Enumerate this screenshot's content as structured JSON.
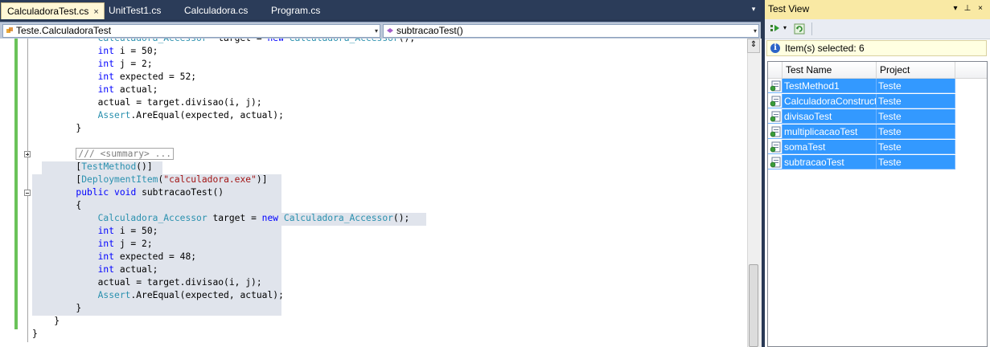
{
  "tabs": [
    {
      "label": "CalculadoraTest.cs",
      "active": true,
      "close": "×"
    },
    {
      "label": "UnitTest1.cs"
    },
    {
      "label": "Calculadora.cs"
    },
    {
      "label": "Program.cs"
    }
  ],
  "tab_dropdown": "▾",
  "nav": {
    "class_combo": "Teste.CalculadoraTest",
    "member_combo": "subtracaoTest()",
    "dropdown_glyph": "▾"
  },
  "code": {
    "lines": [
      {
        "indent": "            ",
        "tokens": [
          [
            "ty",
            "Calculadora_Accessor"
          ],
          [
            "",
            "  target = "
          ],
          [
            "kw",
            "new"
          ],
          [
            "",
            " "
          ],
          [
            "ty",
            "Calculadora_Accessor"
          ],
          [
            "",
            "();"
          ]
        ]
      },
      {
        "indent": "            ",
        "tokens": [
          [
            "kw",
            "int"
          ],
          [
            "",
            " i = 50;"
          ]
        ]
      },
      {
        "indent": "            ",
        "tokens": [
          [
            "kw",
            "int"
          ],
          [
            "",
            " j = 2;"
          ]
        ]
      },
      {
        "indent": "            ",
        "tokens": [
          [
            "kw",
            "int"
          ],
          [
            "",
            " expected = 52;"
          ]
        ]
      },
      {
        "indent": "            ",
        "tokens": [
          [
            "kw",
            "int"
          ],
          [
            "",
            " actual;"
          ]
        ]
      },
      {
        "indent": "            ",
        "tokens": [
          [
            "",
            "actual = target.divisao(i, j);"
          ]
        ]
      },
      {
        "indent": "            ",
        "tokens": [
          [
            "ty",
            "Assert"
          ],
          [
            "",
            ".AreEqual(expected, actual);"
          ]
        ]
      },
      {
        "indent": "        ",
        "tokens": [
          [
            "",
            "}"
          ]
        ]
      },
      {
        "indent": "",
        "tokens": []
      },
      {
        "indent": "        ",
        "tokens": [
          [
            "cm collapsed",
            "/// <summary> ..."
          ]
        ]
      },
      {
        "indent": "        ",
        "tokens": [
          [
            "",
            "["
          ],
          [
            "ty",
            "TestMethod"
          ],
          [
            "",
            "()]"
          ]
        ]
      },
      {
        "indent": "        ",
        "tokens": [
          [
            "",
            "["
          ],
          [
            "ty",
            "DeploymentItem"
          ],
          [
            "",
            "("
          ],
          [
            "st",
            "\"calculadora.exe\""
          ],
          [
            "",
            ")]"
          ]
        ]
      },
      {
        "indent": "        ",
        "tokens": [
          [
            "kw",
            "public"
          ],
          [
            "",
            " "
          ],
          [
            "kw",
            "void"
          ],
          [
            "",
            " subtracaoTest()"
          ]
        ]
      },
      {
        "indent": "        ",
        "tokens": [
          [
            "",
            "{"
          ]
        ]
      },
      {
        "indent": "            ",
        "tokens": [
          [
            "ty",
            "Calculadora_Accessor"
          ],
          [
            "",
            " target = "
          ],
          [
            "kw",
            "new"
          ],
          [
            "",
            " "
          ],
          [
            "ty",
            "Calculadora_Accessor"
          ],
          [
            "",
            "();"
          ]
        ]
      },
      {
        "indent": "            ",
        "tokens": [
          [
            "kw",
            "int"
          ],
          [
            "",
            " i = 50;"
          ]
        ]
      },
      {
        "indent": "            ",
        "tokens": [
          [
            "kw",
            "int"
          ],
          [
            "",
            " j = 2;"
          ]
        ]
      },
      {
        "indent": "            ",
        "tokens": [
          [
            "kw",
            "int"
          ],
          [
            "",
            " expected = 48;"
          ]
        ]
      },
      {
        "indent": "            ",
        "tokens": [
          [
            "kw",
            "int"
          ],
          [
            "",
            " actual;"
          ]
        ]
      },
      {
        "indent": "            ",
        "tokens": [
          [
            "",
            "actual = target.divisao(i, j);"
          ]
        ]
      },
      {
        "indent": "            ",
        "tokens": [
          [
            "ty",
            "Assert"
          ],
          [
            "",
            ".AreEqual(expected, actual);"
          ]
        ]
      },
      {
        "indent": "        ",
        "tokens": [
          [
            "",
            "}"
          ]
        ]
      },
      {
        "indent": "    ",
        "tokens": [
          [
            "",
            "}"
          ]
        ]
      },
      {
        "indent": "",
        "tokens": [
          [
            "",
            "}"
          ]
        ]
      }
    ]
  },
  "test_view": {
    "title": "Test View",
    "pin": "⊥",
    "close": "×",
    "menu": "▾",
    "info": "Item(s) selected: 6",
    "columns": [
      "Test Name",
      "Project"
    ],
    "rows": [
      {
        "name": "TestMethod1",
        "project": "Teste"
      },
      {
        "name": "CalculadoraConstructorTest",
        "project": "Teste"
      },
      {
        "name": "divisaoTest",
        "project": "Teste"
      },
      {
        "name": "multiplicacaoTest",
        "project": "Teste"
      },
      {
        "name": "somaTest",
        "project": "Teste"
      },
      {
        "name": "subtracaoTest",
        "project": "Teste"
      }
    ]
  },
  "colors": {
    "accent": "#3399ff",
    "keyword": "#0000ff",
    "type": "#2b91af",
    "string": "#a31515",
    "comment": "#808080",
    "change_bar": "#6ac259"
  }
}
